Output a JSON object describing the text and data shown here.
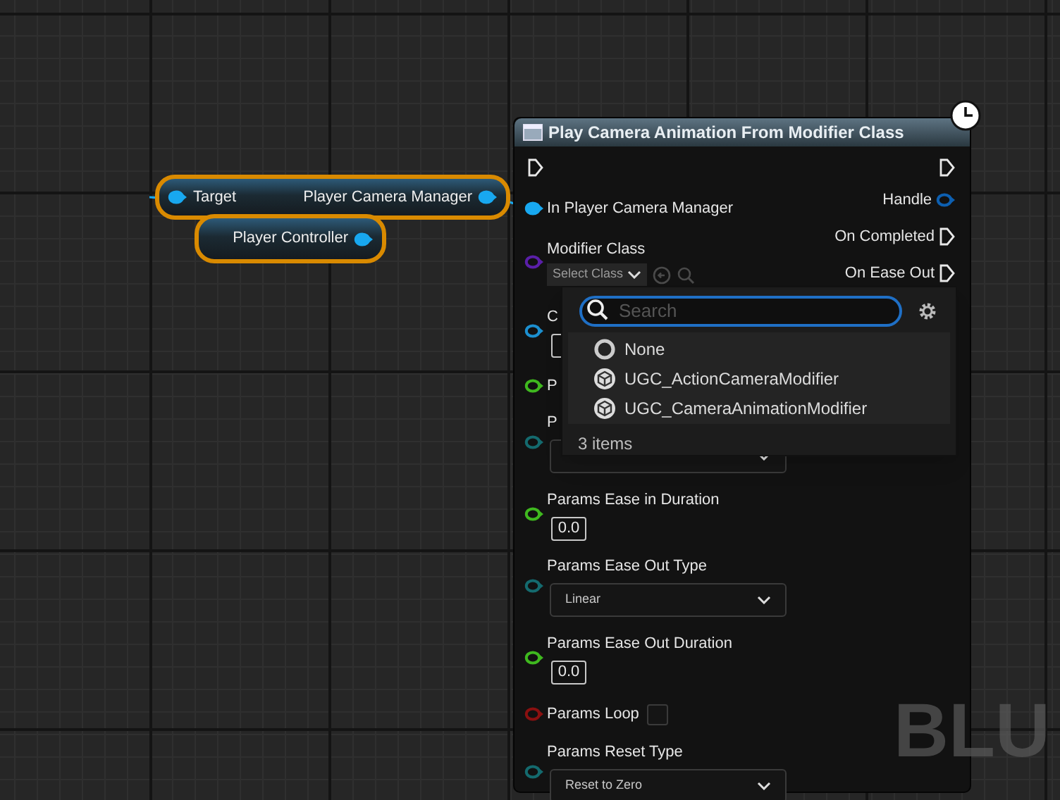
{
  "graph_nodes": [
    {
      "selected": true,
      "inputs": [
        {
          "label": "Target"
        }
      ],
      "outputs": [
        {
          "label": "Player Camera Manager"
        }
      ]
    },
    {
      "selected": true,
      "outputs": [
        {
          "label": "Player Controller"
        }
      ]
    }
  ],
  "function_node": {
    "title": "Play Camera Animation From Modifier Class",
    "inputs": [
      {
        "kind": "pin",
        "label": "In Player Camera Manager",
        "color": "#18a8f0",
        "connected": true
      },
      {
        "kind": "class",
        "label": "Modifier Class",
        "color": "#5a1fa8",
        "connected": false,
        "value": "Select Class"
      },
      {
        "kind": "number",
        "label": "C",
        "color": "#1c8fcf",
        "connected": false
      },
      {
        "kind": "pin",
        "label": "P",
        "color": "#3fb81f",
        "connected": false
      },
      {
        "kind": "dropdown",
        "label": "P",
        "color": "#146a6e",
        "connected": false
      },
      {
        "kind": "number",
        "label": "Params Ease in Duration",
        "color": "#3fb81f",
        "connected": false,
        "value": "0.0"
      },
      {
        "kind": "dropdown",
        "label": "Params Ease Out Type",
        "color": "#146a6e",
        "connected": false,
        "value": "Linear"
      },
      {
        "kind": "number",
        "label": "Params Ease Out Duration",
        "color": "#3fb81f",
        "connected": false,
        "value": "0.0"
      },
      {
        "kind": "checkbox",
        "label": "Params Loop",
        "color": "#8a1010",
        "connected": false,
        "checked": false
      },
      {
        "kind": "dropdown",
        "label": "Params Reset Type",
        "color": "#146a6e",
        "connected": false,
        "value": "Reset to Zero"
      }
    ],
    "outputs": [
      {
        "kind": "data",
        "label": "Handle",
        "color": "#0d5fb0"
      },
      {
        "kind": "exec",
        "label": "On Completed"
      },
      {
        "kind": "exec",
        "label": "On Ease Out"
      }
    ]
  },
  "class_picker": {
    "search": {
      "placeholder": "Search"
    },
    "items": [
      {
        "kind": "none",
        "label": "None"
      },
      {
        "kind": "class",
        "label": "UGC_ActionCameraModifier"
      },
      {
        "kind": "class",
        "label": "UGC_CameraAnimationModifier"
      }
    ],
    "count": "3 items"
  },
  "graph_watermark": "BLU"
}
